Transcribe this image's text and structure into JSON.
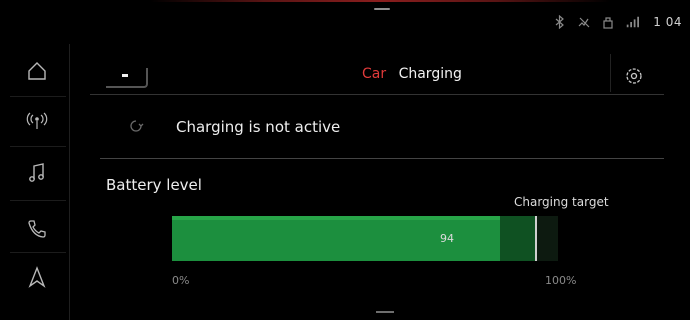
{
  "status_bar": {
    "time": "1 04",
    "icons": [
      "bluetooth-icon",
      "mute-icon",
      "profile-icon",
      "signal-icon"
    ]
  },
  "sidebar": {
    "items": [
      {
        "icon": "home-icon"
      },
      {
        "icon": "radio-icon"
      },
      {
        "icon": "music-icon"
      },
      {
        "icon": "phone-icon"
      },
      {
        "icon": "navigation-icon"
      }
    ]
  },
  "header": {
    "breadcrumb": "Car",
    "title": "Charging"
  },
  "charging_status": {
    "text": "Charging is not active",
    "icon": "charging-status-icon"
  },
  "battery": {
    "label": "Battery level",
    "target_label": "Charging target",
    "level_percent": 85,
    "target_value": "94",
    "target_percent": 94,
    "scale_min": "0%",
    "scale_max": "100%"
  },
  "colors": {
    "accent": "#e03a3a",
    "bar_fill": "#1c8f3e",
    "bar_tail": "#0f5122"
  }
}
